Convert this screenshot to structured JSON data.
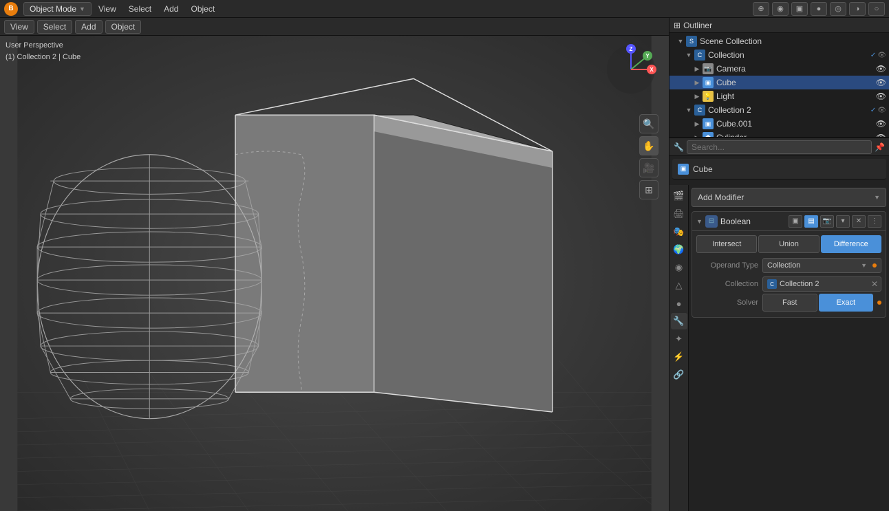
{
  "topbar": {
    "logo": "B",
    "mode_label": "Object Mode",
    "menu_items": [
      "View",
      "Select",
      "Add",
      "Object"
    ],
    "icons": [
      "gizmo-icon",
      "overlay-icon",
      "viewport-shading-icon"
    ]
  },
  "viewport": {
    "perspective_label": "User Perspective",
    "context_label": "(1) Collection 2 | Cube",
    "toolbar_items": [
      "View",
      "Select",
      "Add",
      "Object"
    ]
  },
  "nav_gizmo": {
    "x_label": "X",
    "y_label": "Y",
    "z_label": "Z"
  },
  "outliner": {
    "title": "Scene Collection",
    "items": [
      {
        "level": 0,
        "name": "Scene Collection",
        "type": "scene",
        "has_arrow": true,
        "expanded": true
      },
      {
        "level": 1,
        "name": "Collection",
        "type": "collection",
        "has_arrow": true,
        "expanded": true,
        "has_check": true
      },
      {
        "level": 2,
        "name": "Camera",
        "type": "camera",
        "has_arrow": true
      },
      {
        "level": 2,
        "name": "Cube",
        "type": "mesh",
        "has_arrow": true,
        "selected": true
      },
      {
        "level": 2,
        "name": "Light",
        "type": "light",
        "has_arrow": true
      },
      {
        "level": 1,
        "name": "Collection 2",
        "type": "collection",
        "has_arrow": true,
        "expanded": true,
        "has_check": true
      },
      {
        "level": 2,
        "name": "Cube.001",
        "type": "mesh",
        "has_arrow": true
      },
      {
        "level": 2,
        "name": "Cylinder",
        "type": "mesh",
        "has_arrow": true
      }
    ]
  },
  "properties": {
    "search_placeholder": "Search...",
    "object_name": "Cube",
    "add_modifier_label": "Add Modifier",
    "modifier": {
      "name": "Boolean",
      "operations": [
        "Intersect",
        "Union",
        "Difference"
      ],
      "active_operation": "Difference",
      "operand_type_label": "Operand Type",
      "operand_type_value": "Collection",
      "collection_label": "Collection",
      "collection_value": "Collection 2",
      "solver_label": "Solver",
      "solver_options": [
        "Fast",
        "Exact"
      ],
      "active_solver": "Exact"
    },
    "tabs": [
      "render",
      "output",
      "view_layer",
      "scene",
      "world",
      "object",
      "mesh",
      "material",
      "modifier",
      "particles",
      "physics",
      "constraints",
      "object_data"
    ]
  }
}
